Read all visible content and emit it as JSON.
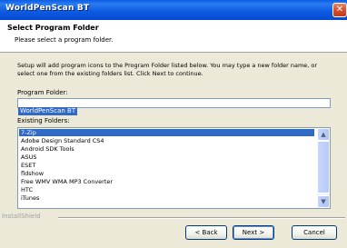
{
  "window": {
    "title": "WorldPenScan BT",
    "close_glyph": "✕"
  },
  "header": {
    "title": "Select Program Folder",
    "subtitle": "Please select a program folder."
  },
  "instructions": "Setup will add program icons to the Program Folder listed below. You may type a new folder name, or select one from the existing folders list. Click Next to continue.",
  "program_folder": {
    "label": "Program Folder:",
    "value": "WorldPenScan BT"
  },
  "existing_folders": {
    "label": "Existing Folders:",
    "items": [
      "7-Zip",
      "Adobe Design Standard CS4",
      "Android SDK Tools",
      "ASUS",
      "ESET",
      "fldshow",
      "Free WMV WMA MP3 Converter",
      "HTC",
      "iTunes"
    ],
    "selected_index": 0,
    "scroll_up_glyph": "▲",
    "scroll_down_glyph": "▼"
  },
  "branding": "InstallShield",
  "buttons": {
    "back": "< Back",
    "next": "Next >",
    "cancel": "Cancel"
  },
  "colors": {
    "title_bar": "#0a5de6",
    "selection": "#316ac5",
    "dialog_bg": "#ece9d8"
  }
}
